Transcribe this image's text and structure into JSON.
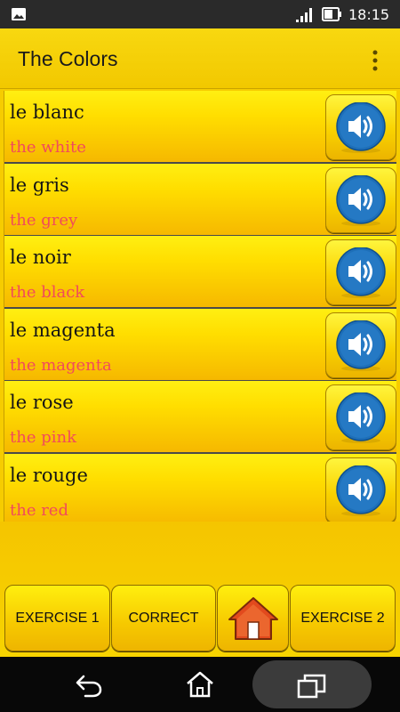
{
  "status_bar": {
    "time": "18:15"
  },
  "app_bar": {
    "title": "The Colors"
  },
  "words": [
    {
      "word": "le blanc",
      "translation": "the white"
    },
    {
      "word": "le gris",
      "translation": "the grey"
    },
    {
      "word": "le noir",
      "translation": "the black"
    },
    {
      "word": "le magenta",
      "translation": "the magenta"
    },
    {
      "word": "le rose",
      "translation": "the pink"
    },
    {
      "word": "le rouge",
      "translation": "the red"
    }
  ],
  "bottom_bar": {
    "exercise1_label": "EXERCISE 1",
    "correct_label": "CORRECT",
    "exercise2_label": "EXERCISE 2"
  },
  "colors": {
    "app_yellow": "#f6cc00",
    "translation_red": "#f24a5b",
    "speaker_blue": "#1e6fb8",
    "home_red": "#e24a1d"
  }
}
